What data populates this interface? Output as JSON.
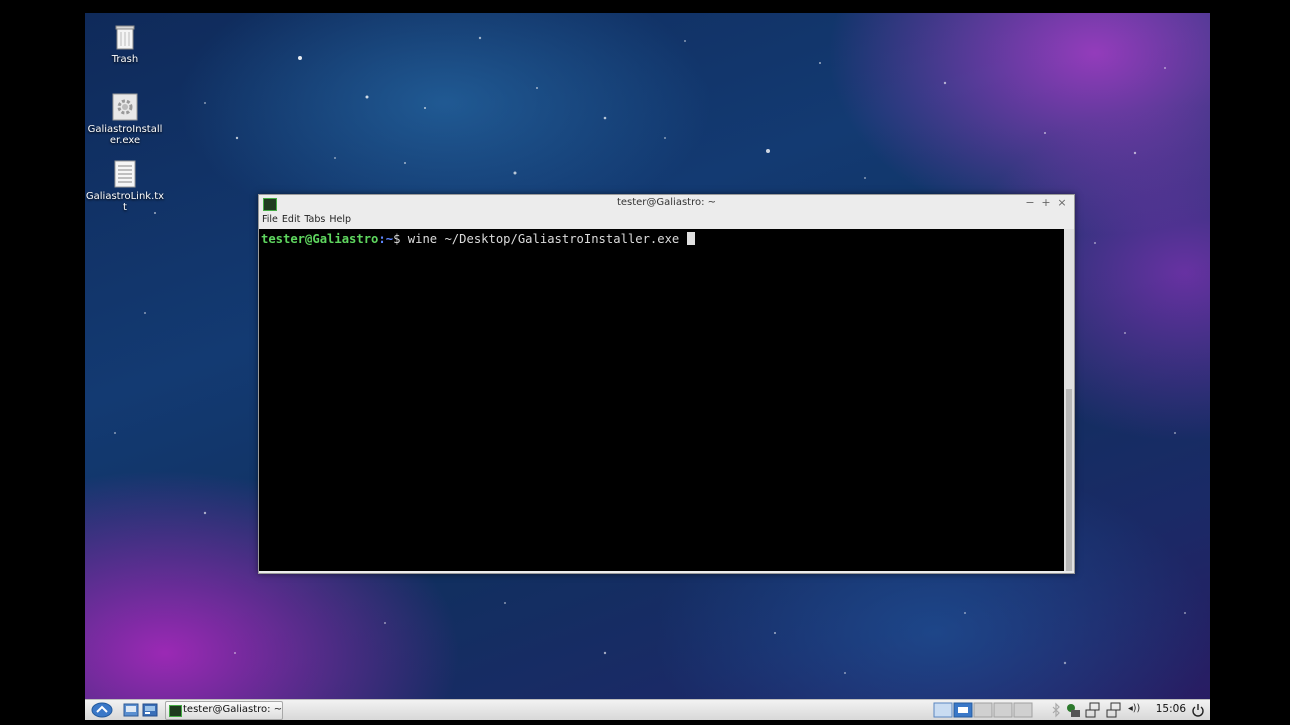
{
  "desktop": {
    "icons": [
      {
        "label": "Trash",
        "icon": "trash-icon"
      },
      {
        "label": "GaliastroInstaller.exe",
        "icon": "gear-icon"
      },
      {
        "label": "GaliastroLink.txt",
        "icon": "text-file-icon"
      }
    ]
  },
  "terminal": {
    "title": "tester@Galiastro: ~",
    "window_buttons": {
      "minimize": "−",
      "maximize": "+",
      "close": "×"
    },
    "menu": [
      "File",
      "Edit",
      "Tabs",
      "Help"
    ],
    "prompt_user": "tester@Galiastro",
    "prompt_path": ":~",
    "prompt_symbol": "$ ",
    "command": "wine ~/Desktop/GaliastroInstaller.exe ",
    "colors": {
      "user": "#5fd75f",
      "path": "#5f87ff",
      "text": "#dcdcdc",
      "bg": "#000000"
    }
  },
  "taskbar": {
    "task_label": "tester@Galiastro: ~",
    "volume_label": "◂))",
    "clock": "15:06"
  }
}
